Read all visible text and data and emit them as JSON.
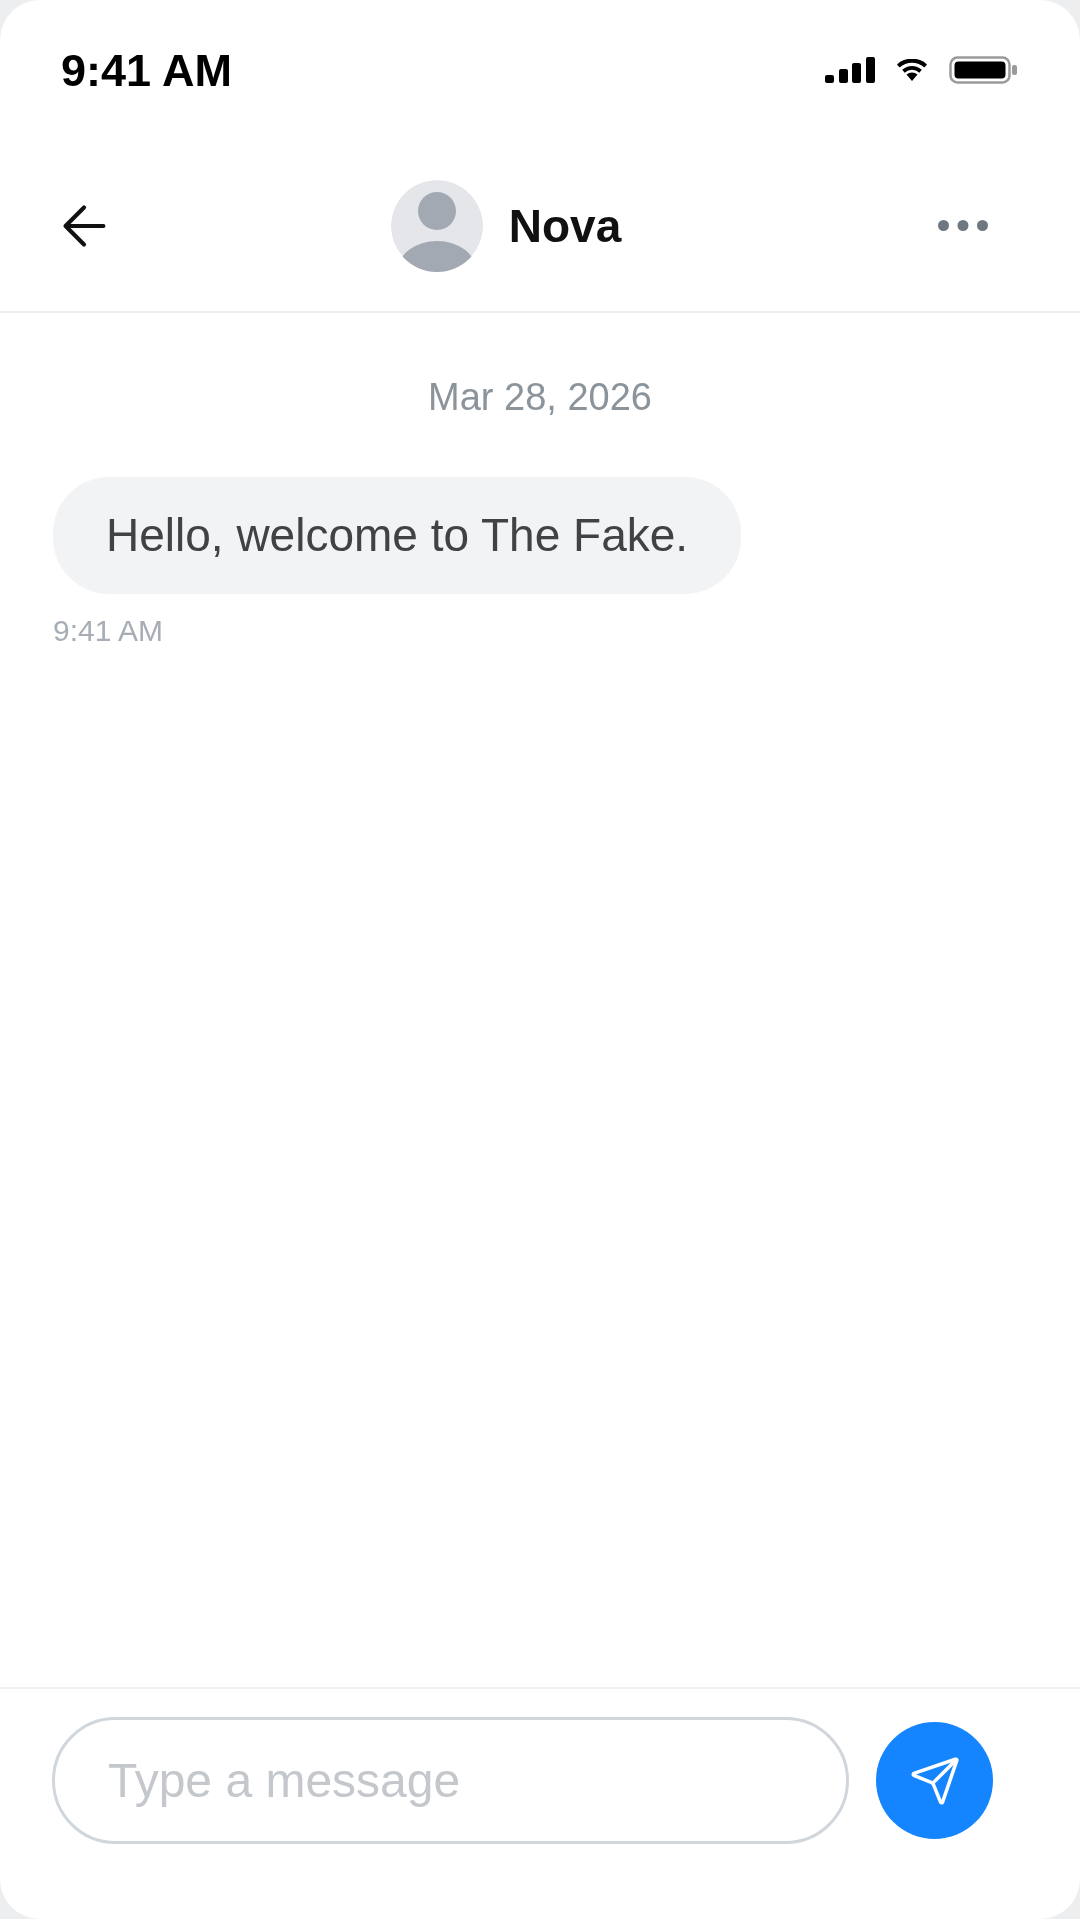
{
  "status_bar": {
    "time": "9:41 AM"
  },
  "header": {
    "contact_name": "Nova"
  },
  "conversation": {
    "date": "Mar 28, 2026",
    "messages": [
      {
        "kind": "received",
        "text": "Hello, welcome to The Fake.",
        "time": "9:41 AM"
      }
    ]
  },
  "composer": {
    "placeholder": "Type a message"
  }
}
